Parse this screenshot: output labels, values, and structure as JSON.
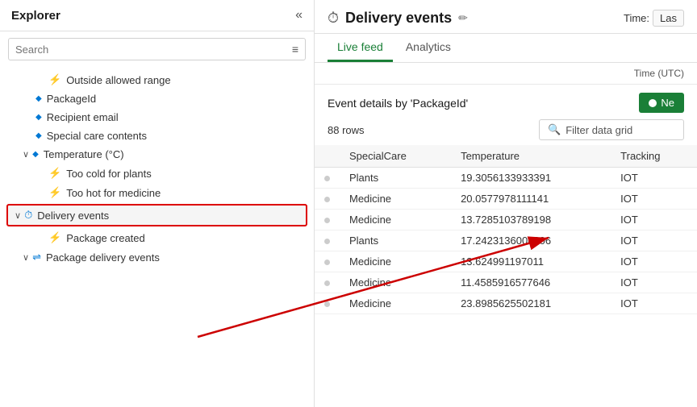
{
  "sidebar": {
    "title": "Explorer",
    "search_placeholder": "Search",
    "items": [
      {
        "id": "outside-allowed-range",
        "label": "Outside allowed range",
        "indent": 3,
        "icon": "⚡",
        "expand": false
      },
      {
        "id": "packageid",
        "label": "PackageId",
        "indent": 2,
        "icon": "🔷",
        "expand": false
      },
      {
        "id": "recipient-email",
        "label": "Recipient email",
        "indent": 2,
        "icon": "🔷",
        "expand": false
      },
      {
        "id": "special-care-contents",
        "label": "Special care contents",
        "indent": 2,
        "icon": "🔷",
        "expand": false
      },
      {
        "id": "temperature",
        "label": "Temperature (°C)",
        "indent": 1,
        "icon": "🔷",
        "expand": true,
        "expanded": true
      },
      {
        "id": "too-cold",
        "label": "Too cold for plants",
        "indent": 3,
        "icon": "⚡",
        "expand": false
      },
      {
        "id": "too-hot",
        "label": "Too hot for medicine",
        "indent": 3,
        "icon": "⚡",
        "expand": false
      },
      {
        "id": "delivery-events",
        "label": "Delivery events",
        "indent": 1,
        "icon": "⏱",
        "expand": true,
        "expanded": true,
        "highlighted": true
      },
      {
        "id": "package-created",
        "label": "Package created",
        "indent": 3,
        "icon": "⚡",
        "expand": false
      },
      {
        "id": "package-delivery-events",
        "label": "Package delivery events",
        "indent": 1,
        "icon": "🔀",
        "expand": true,
        "expanded": false
      }
    ]
  },
  "main": {
    "icon": "⏱",
    "title": "Delivery events",
    "edit_icon": "✏",
    "time_label": "Time:",
    "time_value": "Las",
    "tabs": [
      {
        "id": "live-feed",
        "label": "Live feed",
        "active": true
      },
      {
        "id": "analytics",
        "label": "Analytics",
        "active": false
      }
    ],
    "time_utc_label": "Time (UTC)",
    "event_details_title": "Event details by 'PackageId'",
    "new_button_label": "Ne",
    "rows_count": "88 rows",
    "filter_placeholder": "Filter data grid",
    "table": {
      "columns": [
        "",
        "SpecialCare",
        "Temperature",
        "Tracking"
      ],
      "rows": [
        {
          "dot": true,
          "specialCare": "Plants",
          "temperature": "19.3056133933391",
          "tracking": "IOT"
        },
        {
          "dot": true,
          "specialCare": "Medicine",
          "temperature": "20.0577978111141",
          "tracking": "IOT"
        },
        {
          "dot": true,
          "specialCare": "Medicine",
          "temperature": "13.7285103789198",
          "tracking": "IOT"
        },
        {
          "dot": true,
          "specialCare": "Plants",
          "temperature": "17.2423136006306",
          "tracking": "IOT"
        },
        {
          "dot": true,
          "specialCare": "Medicine",
          "temperature": "13.624991197011",
          "tracking": "IOT"
        },
        {
          "dot": true,
          "specialCare": "Medicine",
          "temperature": "11.4585916577646",
          "tracking": "IOT"
        },
        {
          "dot": true,
          "specialCare": "Medicine",
          "temperature": "23.8985625502181",
          "tracking": "IOT"
        }
      ]
    }
  },
  "arrow": {
    "color": "#cc0000"
  }
}
